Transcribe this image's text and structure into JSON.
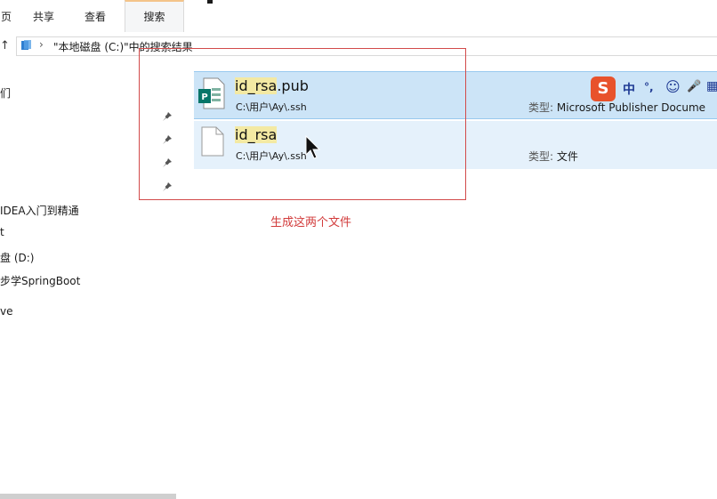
{
  "ribbon": {
    "tabs": [
      {
        "label": "页"
      },
      {
        "label": "共享"
      },
      {
        "label": "查看"
      },
      {
        "label": "搜索"
      }
    ]
  },
  "address": {
    "path_text": "\"本地磁盘 (C:)\"中的搜索结果"
  },
  "sidebar": {
    "items": [
      {
        "label": "们"
      },
      {
        "label": "IDEA入门到精通"
      },
      {
        "label": "t"
      },
      {
        "label": "盘 (D:)"
      },
      {
        "label": "步学SpringBoot"
      },
      {
        "label": "ve"
      }
    ]
  },
  "results": [
    {
      "name_highlight": "id_rsa",
      "name_rest": ".pub",
      "path": "C:\\用户\\Ay\\.ssh",
      "type_label": "类型:",
      "type_value": "Microsoft Publisher Docume",
      "icon": "publisher-file-icon"
    },
    {
      "name_highlight": "id_rsa",
      "name_rest": "",
      "path": "C:\\用户\\Ay\\.ssh",
      "type_label": "类型:",
      "type_value": "文件",
      "icon": "generic-file-icon"
    }
  ],
  "ime": {
    "logo": "S",
    "mode": "中",
    "punct": "°,",
    "emoji": "☺",
    "mic": "🎤",
    "grid": "▦"
  },
  "annotation": {
    "text": "生成这两个文件",
    "color": "#d23b3b"
  },
  "colors": {
    "selected_row": "#cce4f7",
    "hover_row": "#e5f1fb",
    "highlight": "#f3e9a3",
    "ime_brand": "#e8522b"
  }
}
